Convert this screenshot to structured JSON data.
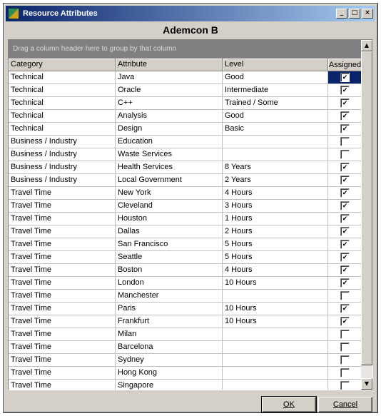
{
  "window": {
    "title": "Resource Attributes"
  },
  "resource_name": "Ademcon B",
  "group_panel_hint": "Drag a column header here to group by that column",
  "columns": [
    "Category",
    "Attribute",
    "Level",
    "Assigned"
  ],
  "rows": [
    {
      "category": "Technical",
      "attribute": "Java",
      "level": "Good",
      "assigned": true,
      "selected": true
    },
    {
      "category": "Technical",
      "attribute": "Oracle",
      "level": "Intermediate",
      "assigned": true
    },
    {
      "category": "Technical",
      "attribute": "C++",
      "level": "Trained / Some",
      "assigned": true
    },
    {
      "category": "Technical",
      "attribute": "Analysis",
      "level": "Good",
      "assigned": true
    },
    {
      "category": "Technical",
      "attribute": "Design",
      "level": "Basic",
      "assigned": true
    },
    {
      "category": "Business / Industry",
      "attribute": "Education",
      "level": "",
      "assigned": false
    },
    {
      "category": "Business / Industry",
      "attribute": "Waste Services",
      "level": "",
      "assigned": false
    },
    {
      "category": "Business / Industry",
      "attribute": "Health Services",
      "level": "8 Years",
      "assigned": true
    },
    {
      "category": "Business / Industry",
      "attribute": "Local Government",
      "level": "2 Years",
      "assigned": true
    },
    {
      "category": "Travel Time",
      "attribute": "New York",
      "level": "4 Hours",
      "assigned": true
    },
    {
      "category": "Travel Time",
      "attribute": "Cleveland",
      "level": "3 Hours",
      "assigned": true
    },
    {
      "category": "Travel Time",
      "attribute": "Houston",
      "level": "1 Hours",
      "assigned": true
    },
    {
      "category": "Travel Time",
      "attribute": "Dallas",
      "level": "2 Hours",
      "assigned": true
    },
    {
      "category": "Travel Time",
      "attribute": "San Francisco",
      "level": "5 Hours",
      "assigned": true
    },
    {
      "category": "Travel Time",
      "attribute": "Seattle",
      "level": "5 Hours",
      "assigned": true
    },
    {
      "category": "Travel Time",
      "attribute": "Boston",
      "level": "4 Hours",
      "assigned": true
    },
    {
      "category": "Travel Time",
      "attribute": "London",
      "level": "10 Hours",
      "assigned": true
    },
    {
      "category": "Travel Time",
      "attribute": "Manchester",
      "level": "",
      "assigned": false
    },
    {
      "category": "Travel Time",
      "attribute": "Paris",
      "level": "10 Hours",
      "assigned": true
    },
    {
      "category": "Travel Time",
      "attribute": "Frankfurt",
      "level": "10 Hours",
      "assigned": true
    },
    {
      "category": "Travel Time",
      "attribute": "Milan",
      "level": "",
      "assigned": false
    },
    {
      "category": "Travel Time",
      "attribute": "Barcelona",
      "level": "",
      "assigned": false
    },
    {
      "category": "Travel Time",
      "attribute": "Sydney",
      "level": "",
      "assigned": false
    },
    {
      "category": "Travel Time",
      "attribute": "Hong Kong",
      "level": "",
      "assigned": false
    },
    {
      "category": "Travel Time",
      "attribute": "Singapore",
      "level": "",
      "assigned": false
    }
  ],
  "buttons": {
    "ok": "OK",
    "cancel": "Cancel"
  },
  "titlebar_buttons": {
    "minimize": "_",
    "maximize": "□",
    "close": "×"
  },
  "scroll_arrows": {
    "up": "▲",
    "down": "▼"
  },
  "colors": {
    "title_start": "#0a246a",
    "title_end": "#a6caf0",
    "face": "#d4d0c8",
    "selection": "#0a246a"
  }
}
